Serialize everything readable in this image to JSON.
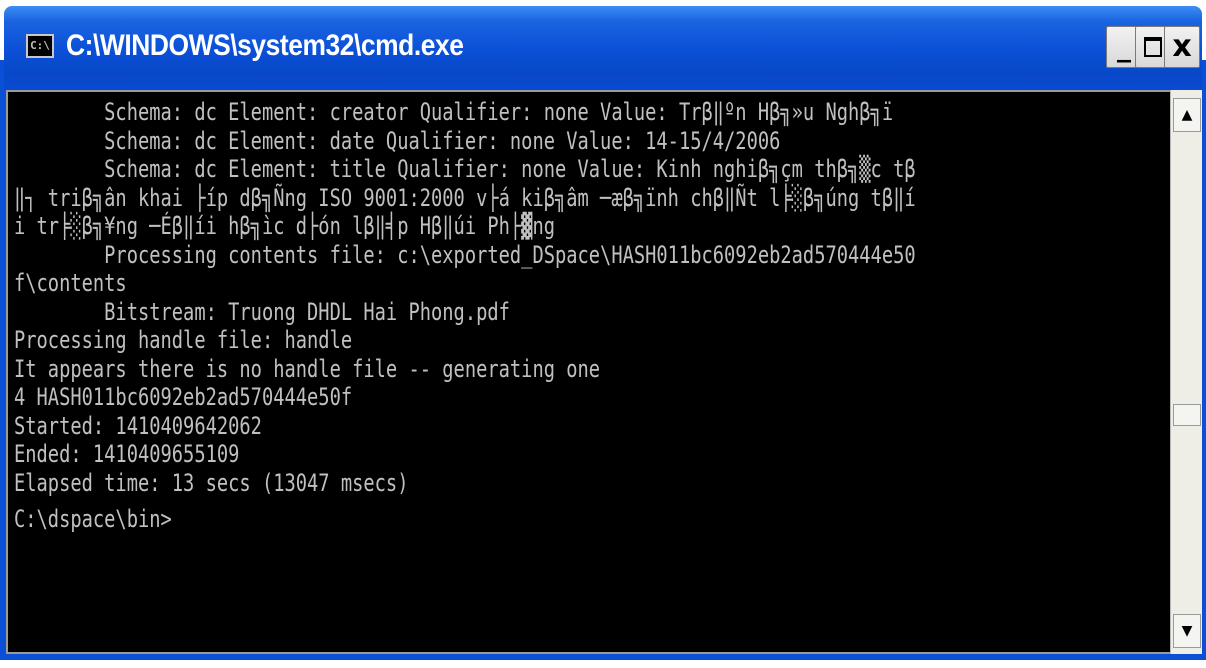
{
  "window": {
    "title": "C:\\WINDOWS\\system32\\cmd.exe",
    "icon": "cmd-console-icon",
    "icon_glyph": "C:\\",
    "controls": {
      "minimize": "_",
      "maximize": "maximize-icon",
      "close": "x"
    }
  },
  "console": {
    "lines": [
      "        Schema: dc Element: creator Qualifier: none Value: Trβ‖ºn Hβ╗»u Nghβ╗ï",
      "        Schema: dc Element: date Qualifier: none Value: 14-15/4/2006",
      "        Schema: dc Element: title Qualifier: none Value: Kinh nghiβ╗çm thβ╗▒c tβ",
      "‖┐ triβ╗ân khai ├íp dβ╗Ñng ISO 9001:2000 v├á kiβ╗âm ─æβ╗ïnh chβ‖Ñt l╞░β╗úng tβ‖í",
      "i tr╞░β╗¥ng ─Éβ‖íi hβ╗ìc d├ón lβ‖╡p Hβ‖úi Ph├▓ng",
      "        Processing contents file: c:\\exported_DSpace\\HASH011bc6092eb2ad570444e50",
      "f\\contents",
      "        Bitstream: Truong DHDL Hai Phong.pdf",
      "Processing handle file: handle",
      "It appears there is no handle file -- generating one",
      "4 HASH011bc6092eb2ad570444e50f",
      "Started: 1410409642062",
      "Ended: 1410409655109",
      "Elapsed time: 13 secs (13047 msecs)"
    ],
    "prompt": "C:\\dspace\\bin>"
  },
  "scrollbar": {
    "up_arrow": "▲",
    "down_arrow": "▼"
  },
  "colors": {
    "titlebar": "#0a4fd6",
    "console_bg": "#000000",
    "console_fg": "#c0c0c0",
    "title_fg": "#ffffff"
  }
}
